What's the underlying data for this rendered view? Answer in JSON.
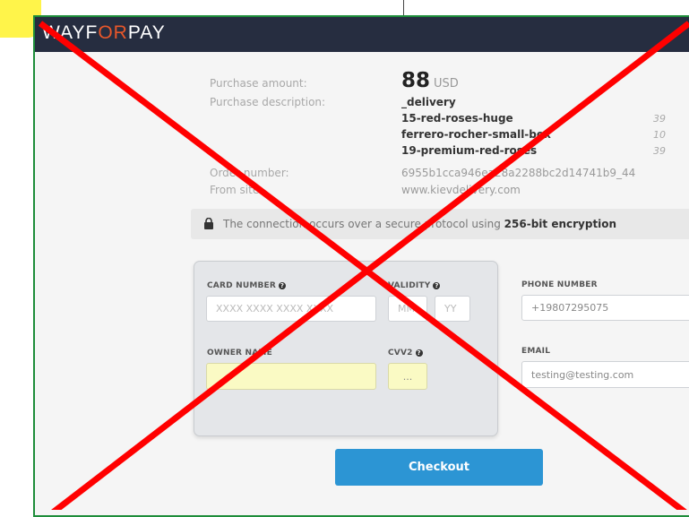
{
  "header": {
    "logo_pre": "WAYF",
    "logo_accent": "OR",
    "logo_post": "PAY"
  },
  "purchase": {
    "amount_label": "Purchase amount:",
    "amount_value": "88",
    "amount_currency": "USD",
    "description_label": "Purchase description:",
    "items": [
      {
        "name": "_delivery",
        "qty": ""
      },
      {
        "name": "15-red-roses-huge",
        "qty": "39"
      },
      {
        "name": "ferrero-rocher-small-box",
        "qty": "10"
      },
      {
        "name": "19-premium-red-roses",
        "qty": "39"
      }
    ],
    "order_label": "Order number:",
    "order_value": "6955b1cca946ea28a2288bc2d14741b9_44",
    "site_label": "From site:",
    "site_value": "www.kievdelivery.com"
  },
  "security": {
    "text": "The connection occurs over a secure protocol using",
    "strong": "256-bit encryption"
  },
  "form": {
    "card_number_label": "CARD NUMBER",
    "card_number_placeholder": "XXXX XXXX XXXX XXXX",
    "validity_label": "VALIDITY",
    "month_placeholder": "MM",
    "year_placeholder": "YY",
    "owner_label": "OWNER NAME",
    "owner_value": "",
    "cvv_label": "CVV2",
    "cvv_placeholder": "...",
    "phone_label": "PHONE NUMBER",
    "phone_value": "+19807295075",
    "email_label": "EMAIL",
    "email_value": "testing@testing.com"
  },
  "checkout_label": "Checkout",
  "colors": {
    "brand": "#262d40",
    "accent": "#e8572a",
    "button": "#2c95d4",
    "cross": "#ff0000",
    "frame": "#1e8d3a"
  }
}
